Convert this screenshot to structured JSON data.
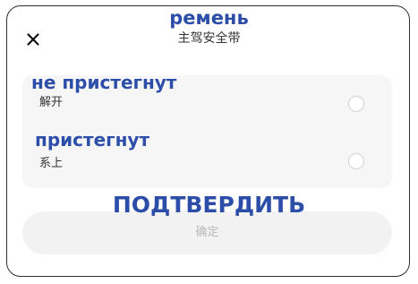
{
  "dialog": {
    "title_translation": "ремень",
    "title": "主驾安全带",
    "close_icon": "close-icon"
  },
  "options": [
    {
      "translation": "не пристегнут",
      "label": "解开",
      "selected": false
    },
    {
      "translation": "пристегнут",
      "label": "系上",
      "selected": false
    }
  ],
  "confirm": {
    "translation": "ПОДТВЕРДИТЬ",
    "label": "确定",
    "enabled": false
  },
  "colors": {
    "translation_text": "#2c4ea8",
    "panel_background": "#f6f6f6",
    "button_background": "#f2f2f2",
    "disabled_text": "#b8b8b8"
  }
}
